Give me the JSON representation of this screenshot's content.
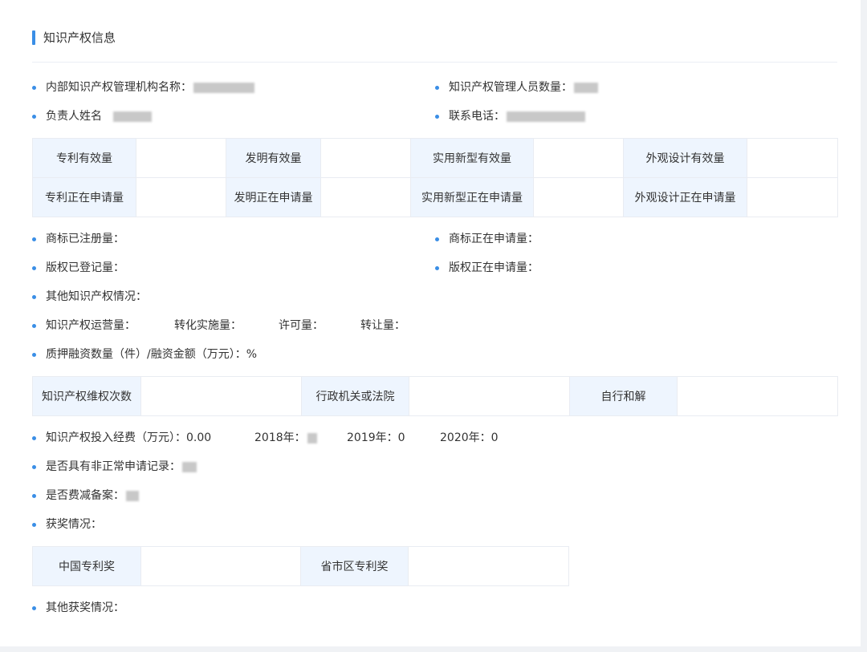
{
  "section": {
    "title": "知识产权信息"
  },
  "info_rows": {
    "org_name_label": "内部知识产权管理机构名称：",
    "staff_count_label": "知识产权管理人员数量：",
    "leader_label": "负责人姓名",
    "phone_label": "联系电话："
  },
  "patent_table": {
    "rows": [
      [
        "专利有效量",
        "发明有效量",
        "实用新型有效量",
        "外观设计有效量"
      ],
      [
        "专利正在申请量",
        "发明正在申请量",
        "实用新型正在申请量",
        "外观设计正在申请量"
      ]
    ]
  },
  "trademark": {
    "registered_label": "商标已注册量：",
    "applying_label": "商标正在申请量：",
    "copyright_registered_label": "版权已登记量：",
    "copyright_applying_label": "版权正在申请量：",
    "other_ip_label": "其他知识产权情况：",
    "operation_label": "知识产权运营量：",
    "transform_label": "转化实施量：",
    "license_label": "许可量：",
    "transfer_label": "转让量：",
    "pledge_label": "质押融资数量（件）/融资金额（万元）：%"
  },
  "rights_table": {
    "labels": [
      "知识产权维权次数",
      "行政机关或法院",
      "自行和解"
    ]
  },
  "funding": {
    "label": "知识产权投入经费（万元）：0.00",
    "y2018": "2018年：",
    "y2019": "2019年：0",
    "y2020": "2020年：0",
    "abnormal_label": "是否具有非正常申请记录：",
    "fee_reduction_label": "是否费减备案：",
    "awards_label": "获奖情况："
  },
  "awards_table": {
    "labels": [
      "中国专利奖",
      "省市区专利奖"
    ]
  },
  "other_awards": {
    "label": "其他获奖情况："
  },
  "colors": {
    "accent": "#3a8ee6",
    "label_cell_bg": "#eef5fe",
    "border": "#e9ecf2"
  }
}
